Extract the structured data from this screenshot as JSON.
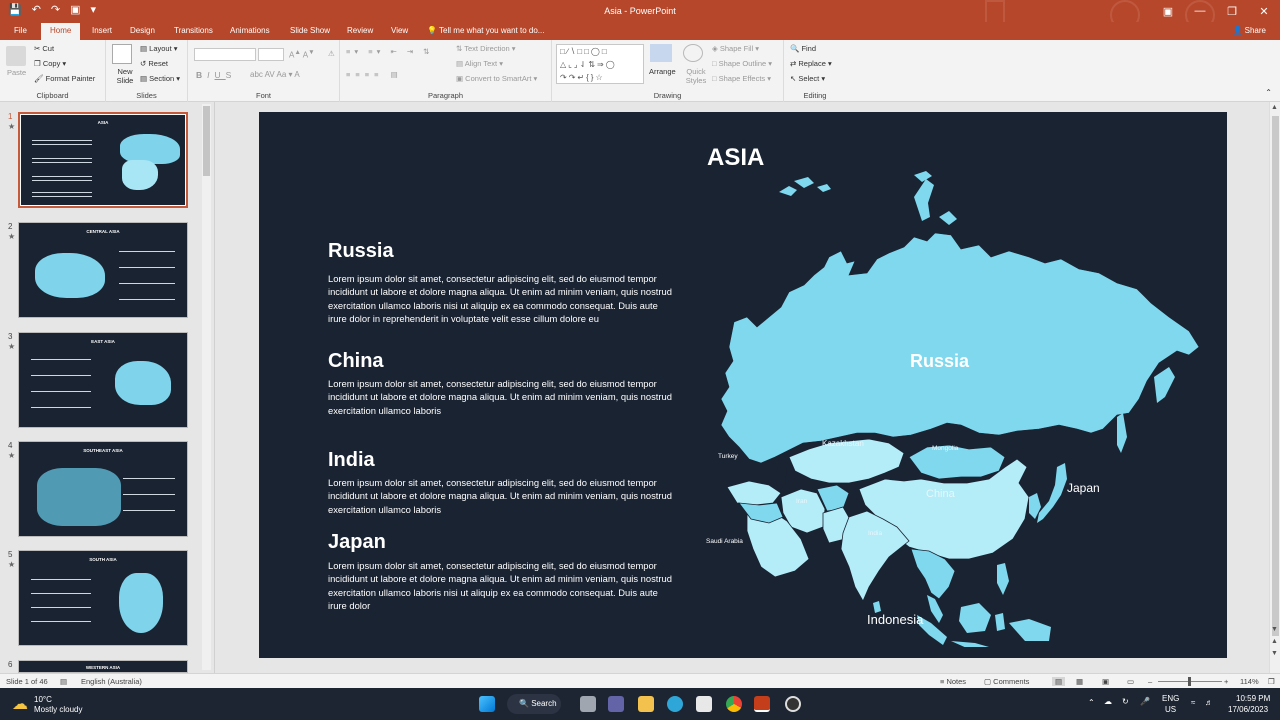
{
  "window": {
    "title": "Asia - PowerPoint",
    "share_label": "Share",
    "tell_me": "Tell me what you want to do..."
  },
  "tabs": [
    "File",
    "Home",
    "Insert",
    "Design",
    "Transitions",
    "Animations",
    "Slide Show",
    "Review",
    "View"
  ],
  "ribbon": {
    "clipboard": {
      "label": "Clipboard",
      "paste": "Paste",
      "cut": "Cut",
      "copy": "Copy",
      "format_painter": "Format Painter"
    },
    "slides": {
      "label": "Slides",
      "new_slide": "New Slide",
      "layout": "Layout",
      "reset": "Reset",
      "section": "Section"
    },
    "font": {
      "label": "Font"
    },
    "paragraph": {
      "label": "Paragraph",
      "text_direction": "Text Direction",
      "align_text": "Align Text",
      "convert_smartart": "Convert to SmartArt"
    },
    "drawing": {
      "label": "Drawing",
      "arrange": "Arrange",
      "quick_styles": "Quick Styles",
      "shape_fill": "Shape Fill",
      "shape_outline": "Shape Outline",
      "shape_effects": "Shape Effects"
    },
    "editing": {
      "label": "Editing",
      "find": "Find",
      "replace": "Replace",
      "select": "Select"
    }
  },
  "thumbnails": [
    {
      "num": "1",
      "title": "ASIA"
    },
    {
      "num": "2",
      "title": "CENTRAL ASIA"
    },
    {
      "num": "3",
      "title": "EAST ASIA"
    },
    {
      "num": "4",
      "title": "SOUTHEAST ASIA"
    },
    {
      "num": "5",
      "title": "SOUTH ASIA"
    },
    {
      "num": "6",
      "title": "WESTERN ASIA"
    }
  ],
  "slide": {
    "title": "ASIA",
    "sections": [
      {
        "heading": "Russia",
        "body": "Lorem ipsum dolor sit amet, consectetur adipiscing elit, sed do eiusmod tempor incididunt ut labore et dolore magna aliqua. Ut enim ad minim veniam, quis nostrud exercitation ullamco laboris nisi ut aliquip ex ea commodo consequat. Duis aute irure dolor in reprehenderit in voluptate velit esse cillum dolore eu"
      },
      {
        "heading": "China",
        "body": "Lorem ipsum dolor sit amet, consectetur adipiscing elit, sed do eiusmod tempor incididunt ut labore et dolore magna aliqua. Ut enim ad minim veniam, quis nostrud exercitation ullamco laboris"
      },
      {
        "heading": "India",
        "body": "Lorem ipsum dolor sit amet, consectetur adipiscing elit, sed do eiusmod tempor incididunt ut labore et dolore magna aliqua. Ut enim ad minim veniam, quis nostrud exercitation ullamco laboris"
      },
      {
        "heading": "Japan",
        "body": "Lorem ipsum dolor sit amet, consectetur adipiscing elit, sed do eiusmod tempor incididunt ut labore et dolore magna aliqua. Ut enim ad minim veniam, quis nostrud exercitation ullamco laboris nisi ut aliquip ex ea commodo consequat. Duis aute irure dolor"
      }
    ],
    "map_labels": {
      "russia": "Russia",
      "china": "China",
      "japan": "Japan",
      "indonesia": "Indonesia",
      "turkey": "Turkey",
      "saudi": "Saudi Arabia",
      "kazakhstan": "Kazakhstan",
      "mongolia": "Mongolia",
      "iran": "Iran",
      "india": "India"
    },
    "colors": {
      "background": "#1a2332",
      "land_main": "#7fd8ee",
      "land_light": "#b4ecf8"
    }
  },
  "status": {
    "slide_info": "Slide 1 of 46",
    "language": "English (Australia)",
    "notes": "Notes",
    "comments": "Comments",
    "zoom": "114%"
  },
  "taskbar": {
    "weather_temp": "10°C",
    "weather_desc": "Mostly cloudy",
    "search": "Search",
    "lang": "ENG",
    "region": "US",
    "time": "10:59 PM",
    "date": "17/06/2023"
  }
}
